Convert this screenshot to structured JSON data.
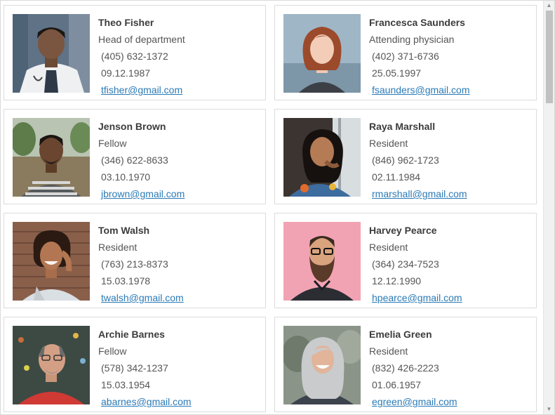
{
  "contacts": [
    {
      "name": "Theo Fisher",
      "role": "Head of department",
      "phone": "(405) 632-1372",
      "date": "09.12.1987",
      "email": "tfisher@gmail.com"
    },
    {
      "name": "Francesca Saunders",
      "role": "Attending physician",
      "phone": "(402) 371-6736",
      "date": "25.05.1997",
      "email": "fsaunders@gmail.com"
    },
    {
      "name": "Jenson Brown",
      "role": "Fellow",
      "phone": "(346) 622-8633",
      "date": "03.10.1970",
      "email": "jbrown@gmail.com"
    },
    {
      "name": "Raya Marshall",
      "role": "Resident",
      "phone": "(846) 962-1723",
      "date": "02.11.1984",
      "email": "rmarshall@gmail.com"
    },
    {
      "name": "Tom Walsh",
      "role": "Resident",
      "phone": "(763) 213-8373",
      "date": "15.03.1978",
      "email": "twalsh@gmail.com"
    },
    {
      "name": "Harvey Pearce",
      "role": "Resident",
      "phone": "(364) 234-7523",
      "date": "12.12.1990",
      "email": "hpearce@gmail.com"
    },
    {
      "name": "Archie Barnes",
      "role": "Fellow",
      "phone": "(578) 342-1237",
      "date": "15.03.1954",
      "email": "abarnes@gmail.com"
    },
    {
      "name": "Emelia Green",
      "role": "Resident",
      "phone": "(832) 426-2223",
      "date": "01.06.1957",
      "email": "egreen@gmail.com"
    }
  ],
  "colors": {
    "link": "#2a7ab6",
    "border": "#dcdcdc",
    "text": "#555555"
  }
}
